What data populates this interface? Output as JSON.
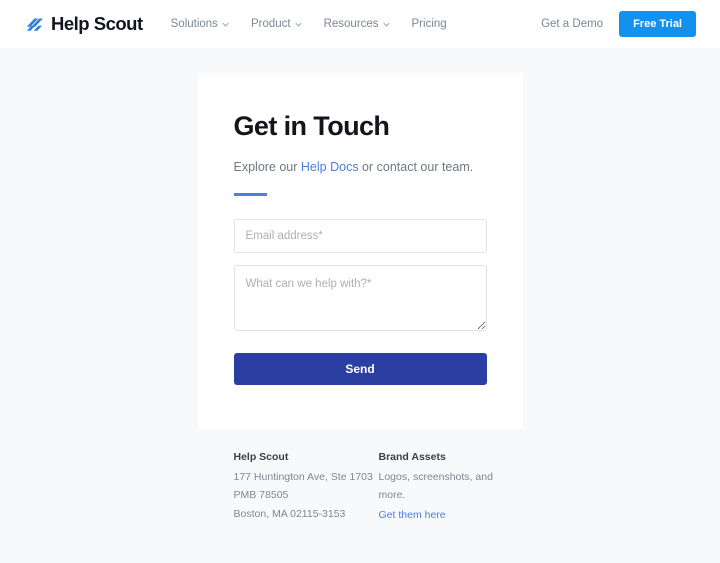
{
  "header": {
    "brand": {
      "name": "Help Scout",
      "logo_icon": "helpscout-slashes-icon",
      "logo_color": "#2f7de1"
    },
    "nav_items": [
      {
        "label": "Solutions",
        "has_dropdown": true
      },
      {
        "label": "Product",
        "has_dropdown": true
      },
      {
        "label": "Resources",
        "has_dropdown": true
      },
      {
        "label": "Pricing",
        "has_dropdown": false
      }
    ],
    "demo_link": "Get a Demo",
    "trial_button": "Free Trial",
    "trial_button_color": "#1292ee"
  },
  "main": {
    "title": "Get in Touch",
    "lede_prefix": "Explore our ",
    "lede_link": "Help Docs",
    "lede_suffix": " or contact our team.",
    "accent_color": "#4c7fd6",
    "form": {
      "email_placeholder": "Email address*",
      "email_value": "",
      "message_placeholder": "What can we help with?*",
      "message_value": "",
      "submit_label": "Send",
      "submit_color": "#2b3fa2"
    }
  },
  "footer": {
    "address": {
      "heading": "Help Scout",
      "lines": [
        "177 Huntington Ave, Ste 1703",
        "PMB 78505",
        "Boston, MA 02115-3153"
      ]
    },
    "brand_assets": {
      "heading": "Brand Assets",
      "description": "Logos, screenshots, and more.",
      "link": "Get them here"
    }
  }
}
